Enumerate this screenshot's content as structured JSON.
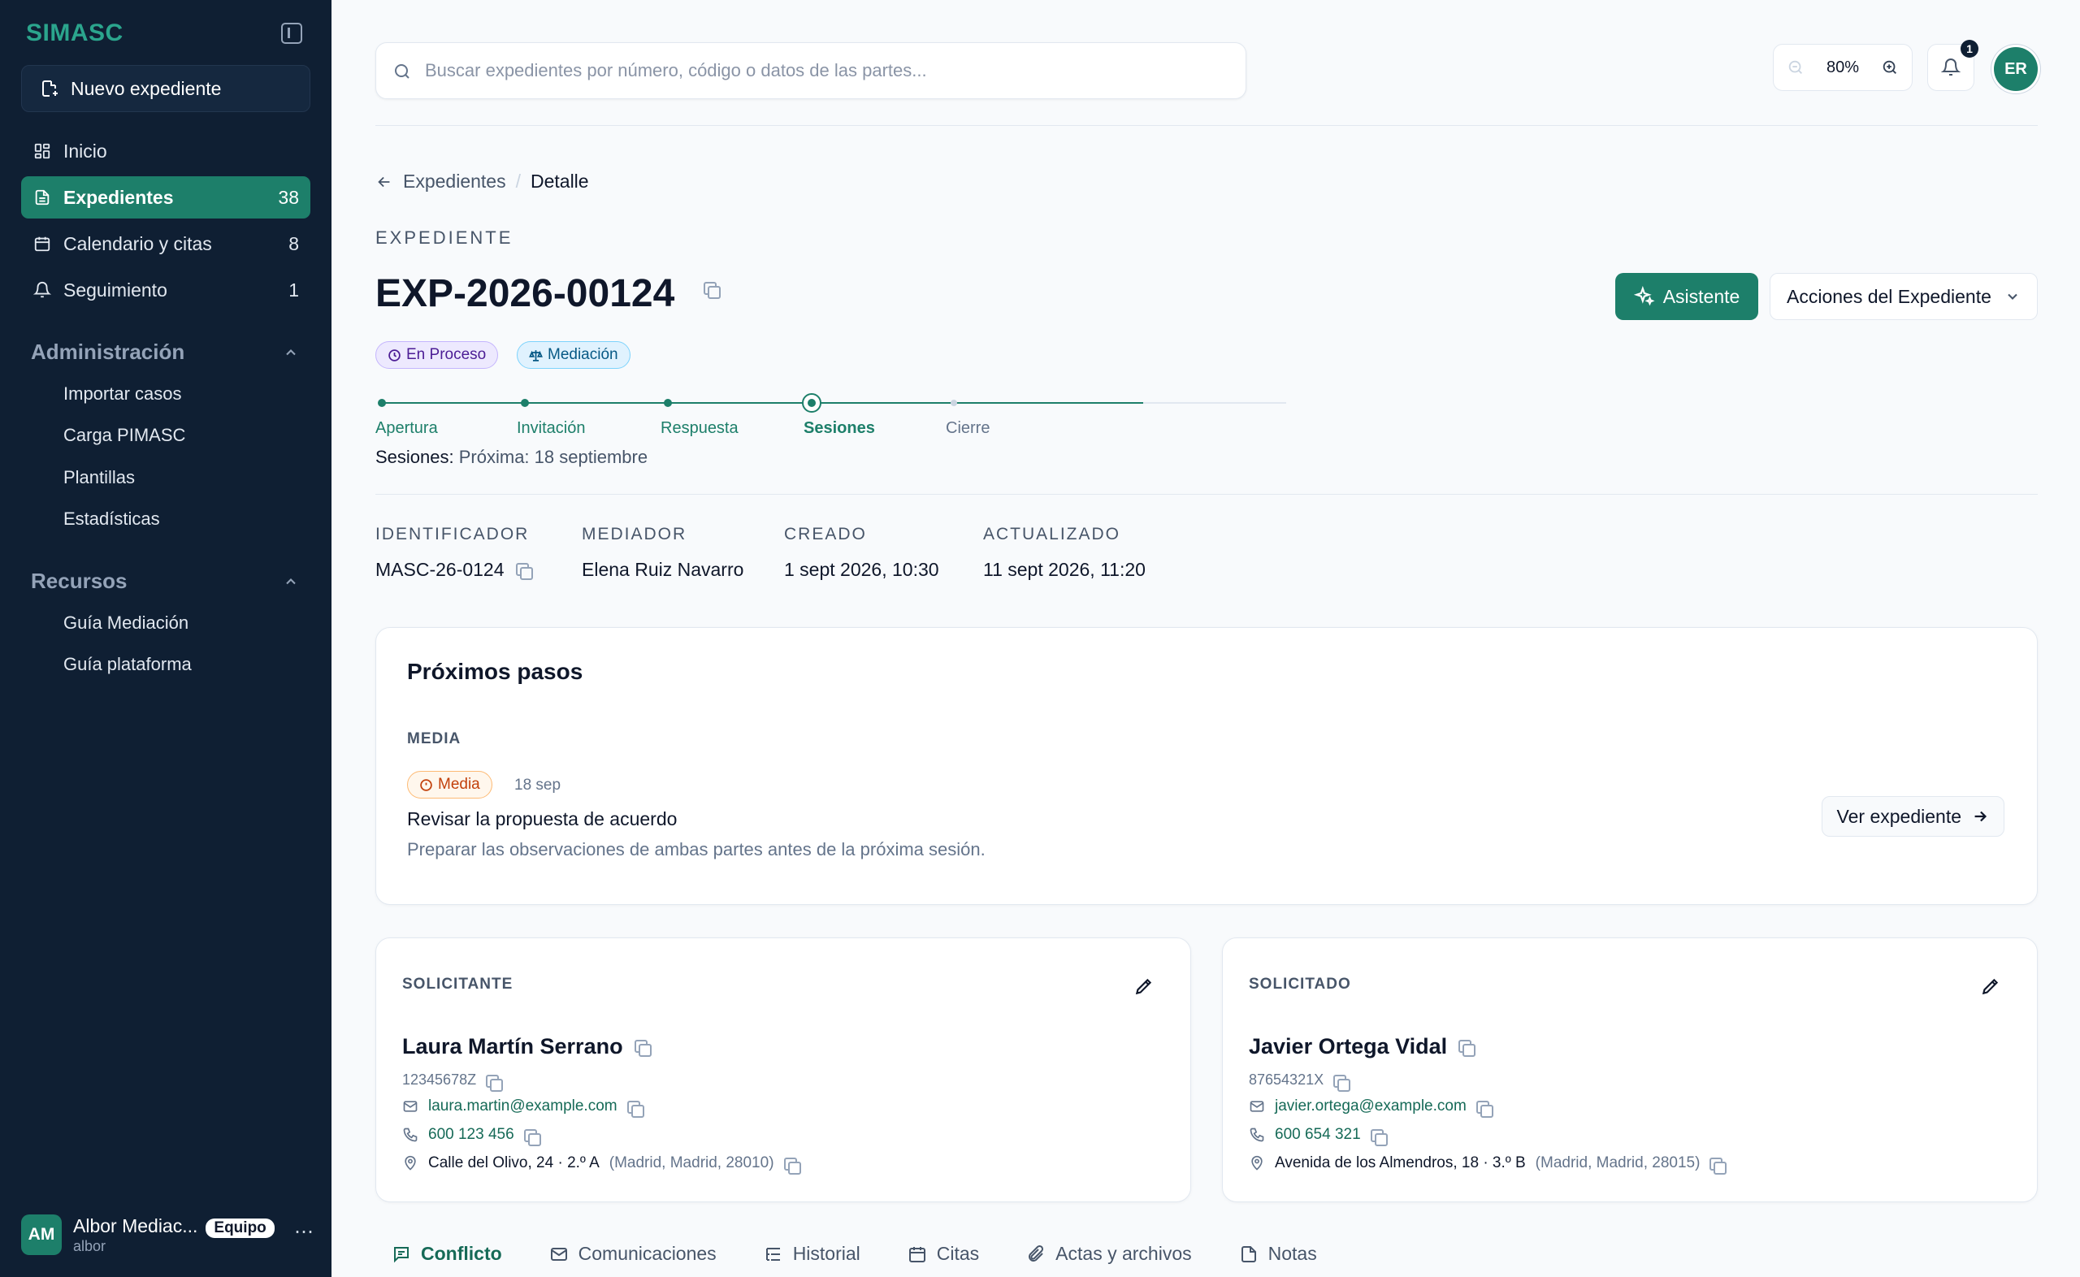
{
  "app": {
    "name": "SIMASC"
  },
  "sidebar": {
    "new_case": "Nuevo expediente",
    "nav": [
      {
        "label": "Inicio",
        "count": "",
        "icon": "grid-icon"
      },
      {
        "label": "Expedientes",
        "count": "38",
        "icon": "file-icon"
      },
      {
        "label": "Calendario y citas",
        "count": "8",
        "icon": "calendar-icon"
      },
      {
        "label": "Seguimiento",
        "count": "1",
        "icon": "bell-icon"
      }
    ],
    "admin_title": "Administración",
    "admin_items": [
      "Importar casos",
      "Carga PIMASC",
      "Plantillas",
      "Estadísticas"
    ],
    "resources_title": "Recursos",
    "resources_items": [
      "Guía Mediación",
      "Guía plataforma"
    ],
    "user": {
      "initials": "AM",
      "name": "Albor Mediac...",
      "team": "Equipo",
      "handle": "albor"
    }
  },
  "topbar": {
    "search_placeholder": "Buscar expedientes por número, código o datos de las partes...",
    "zoom": "80%",
    "notifications": "1",
    "avatar": "ER"
  },
  "breadcrumb": {
    "parent": "Expedientes",
    "separator": "/",
    "current": "Detalle"
  },
  "case": {
    "eyebrow": "EXPEDIENTE",
    "number": "EXP-2026-00124",
    "status": "En Proceso",
    "type": "Mediación",
    "assistant_label": "Asistente",
    "actions_label": "Acciones del Expediente",
    "steps": [
      "Apertura",
      "Invitación",
      "Respuesta",
      "Sesiones",
      "Cierre"
    ],
    "current_step": 3,
    "next_label": "Sesiones:",
    "next_value": "Próxima: 18 septiembre",
    "meta": [
      {
        "key": "IDENTIFICADOR",
        "value": "MASC-26-0124"
      },
      {
        "key": "MEDIADOR",
        "value": "Elena Ruiz Navarro"
      },
      {
        "key": "CREADO",
        "value": "1 sept 2026, 10:30"
      },
      {
        "key": "ACTUALIZADO",
        "value": "11 sept 2026, 11:20"
      }
    ]
  },
  "next_steps": {
    "title": "Próximos pasos",
    "group": "MEDIA",
    "priority": "Media",
    "date": "18 sep",
    "task": "Revisar la propuesta de acuerdo",
    "description": "Preparar las observaciones de ambas partes antes de la próxima sesión.",
    "button": "Ver expediente"
  },
  "parties": [
    {
      "role": "SOLICITANTE",
      "name": "Laura Martín Serrano",
      "id": "12345678Z",
      "email": "laura.martin@example.com",
      "phone": "600 123 456",
      "address": "Calle del Olivo, 24 · 2.º A",
      "city": "(Madrid, Madrid, 28010)"
    },
    {
      "role": "SOLICITADO",
      "name": "Javier Ortega Vidal",
      "id": "87654321X",
      "email": "javier.ortega@example.com",
      "phone": "600 654 321",
      "address": "Avenida de los Almendros, 18 · 3.º B",
      "city": "(Madrid, Madrid, 28015)"
    }
  ],
  "tabs": [
    "Conflicto",
    "Comunicaciones",
    "Historial",
    "Citas",
    "Actas y archivos",
    "Notas"
  ],
  "colors": {
    "accent": "#1d7f6a",
    "sidebar": "#0f1f33"
  }
}
